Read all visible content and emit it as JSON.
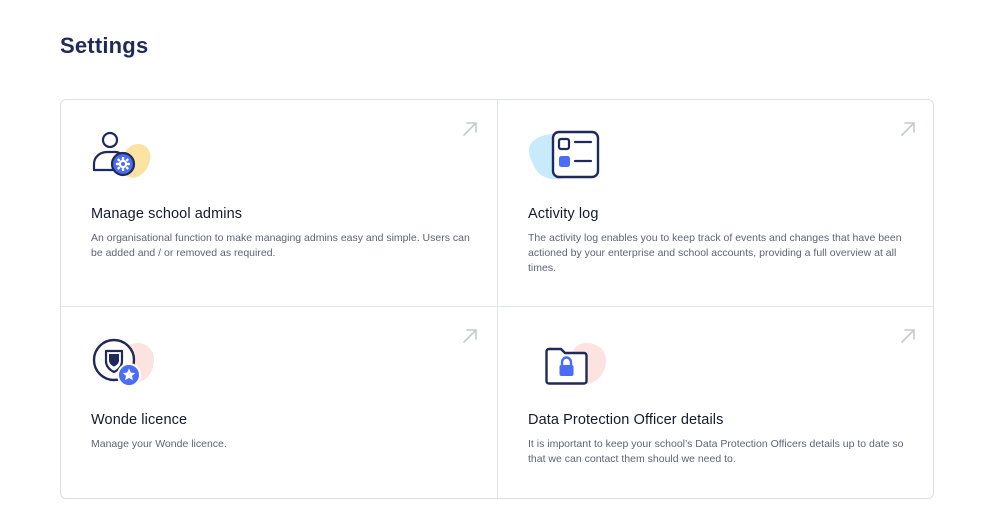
{
  "page": {
    "title": "Settings"
  },
  "colors": {
    "title": "#1f2a5a",
    "icon_stroke": "#1f2a5a",
    "accent_blue": "#4a6cf7",
    "blob_yellow": "#fbe3a2",
    "blob_blue": "#c8ebfb",
    "blob_pink": "#fde3df",
    "arrow": "#c5c9d2"
  },
  "cards": [
    {
      "title": "Manage school admins",
      "description": "An organisational function to make managing admins easy and simple. Users can be added and / or removed as required.",
      "icon": "user-gear-icon"
    },
    {
      "title": "Activity log",
      "description": "The activity log enables you to keep track of events and changes that have been actioned by your enterprise and school accounts, providing a full overview at all times.",
      "icon": "activity-list-icon"
    },
    {
      "title": "Wonde licence",
      "description": "Manage your Wonde licence.",
      "icon": "shield-star-icon"
    },
    {
      "title": "Data Protection Officer details",
      "description": "It is important to keep your school’s Data Protection Officers details up to date so that we can contact them should we need to.",
      "icon": "locked-folder-icon"
    }
  ]
}
